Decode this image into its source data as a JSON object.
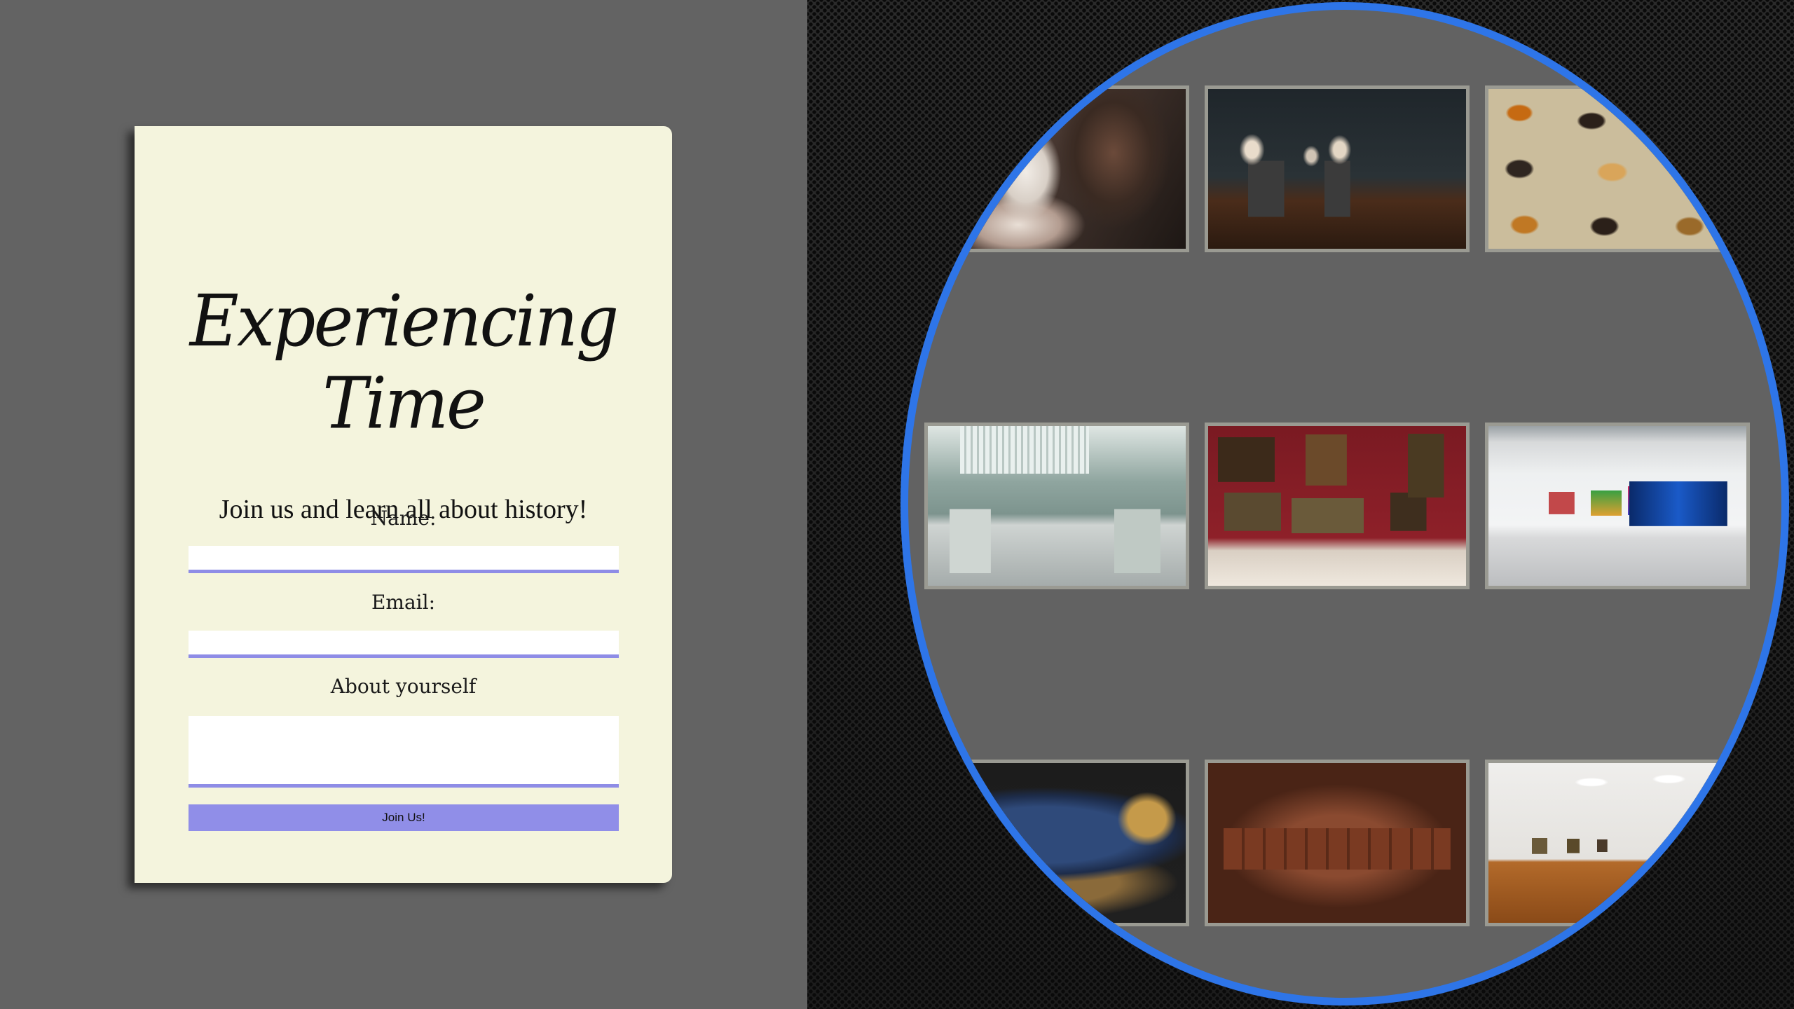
{
  "form": {
    "title": "Experiencing Time",
    "tagline": "Join us and learn all about history!",
    "name_label": "Name:",
    "name_value": "",
    "email_label": "Email:",
    "email_value": "",
    "about_label": "About yourself",
    "about_value": "",
    "submit_label": "Join Us!"
  },
  "gallery": {
    "tiles": [
      {
        "subject": "marble bust"
      },
      {
        "subject": "dark gallery with busts"
      },
      {
        "subject": "butterfly collection"
      },
      {
        "subject": "skylit sculpture hall"
      },
      {
        "subject": "red salon with paintings"
      },
      {
        "subject": "white modern gallery"
      },
      {
        "subject": "egyptian sarcophagus"
      },
      {
        "subject": "lit relief wall"
      },
      {
        "subject": "wood floor gallery"
      }
    ]
  },
  "colors": {
    "accent": "#2e75e8",
    "input_underline": "#8e8ce6",
    "button": "#908ee8",
    "card": "#f4f4dd",
    "page": "#636363"
  }
}
